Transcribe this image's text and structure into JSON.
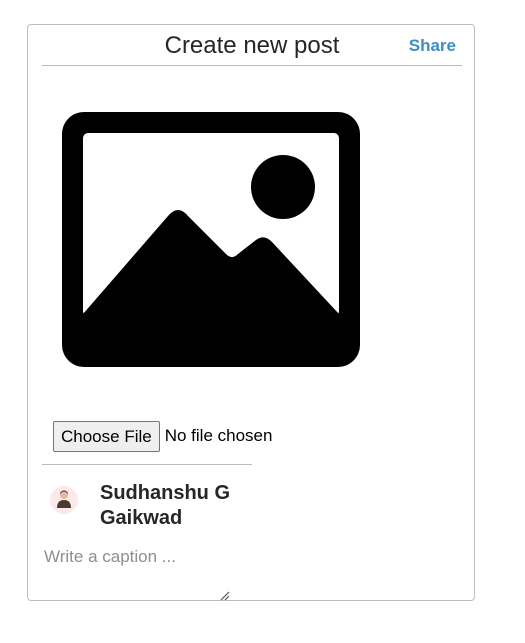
{
  "post_form": {
    "title": "Create new post",
    "share_label": "Share",
    "image_icon": "image-placeholder-icon",
    "file_input": {
      "button_label": "Choose File",
      "status_text": "No file chosen"
    },
    "author": {
      "avatar_icon": "user-avatar",
      "name": "Sudhanshu G Gaikwad"
    },
    "caption": {
      "placeholder": "Write a caption ...",
      "value": ""
    }
  },
  "colors": {
    "share": "#3a8fc7",
    "border": "#bdbdbd",
    "text": "#262626",
    "placeholder": "#8e8e8e"
  }
}
